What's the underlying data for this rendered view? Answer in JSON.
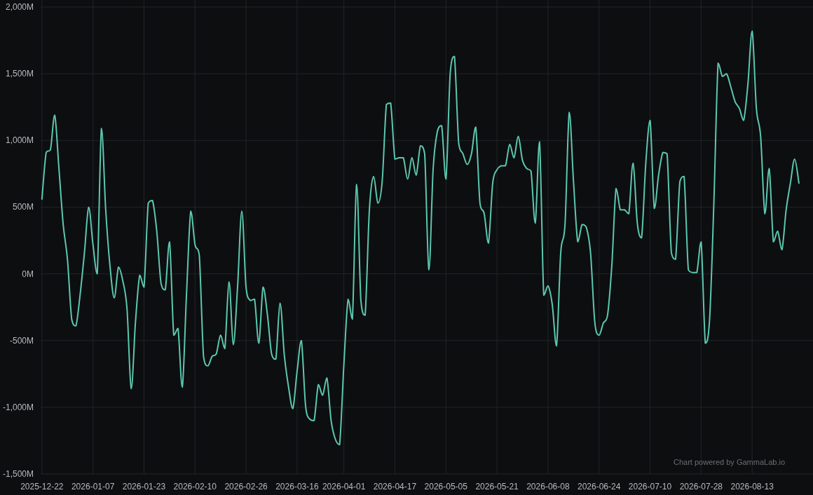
{
  "chart_data": {
    "type": "line",
    "grid": true,
    "ylim": [
      -1500,
      2000
    ],
    "categories": [
      "2025-12-22",
      null,
      null,
      null,
      null,
      null,
      null,
      null,
      null,
      null,
      null,
      null,
      "2026-01-07",
      null,
      null,
      null,
      null,
      null,
      null,
      null,
      null,
      null,
      null,
      null,
      "2026-01-23",
      null,
      null,
      null,
      null,
      null,
      null,
      null,
      null,
      null,
      null,
      null,
      "2026-02-10",
      null,
      null,
      null,
      null,
      null,
      null,
      null,
      null,
      null,
      null,
      null,
      "2026-02-26",
      null,
      null,
      null,
      null,
      null,
      null,
      null,
      null,
      null,
      null,
      null,
      "2026-03-16",
      null,
      null,
      null,
      null,
      null,
      null,
      null,
      null,
      null,
      null,
      "2026-04-01",
      null,
      null,
      null,
      null,
      null,
      null,
      null,
      null,
      null,
      null,
      null,
      "2026-04-17",
      null,
      null,
      null,
      null,
      null,
      null,
      null,
      null,
      null,
      null,
      null,
      "2026-05-05",
      null,
      null,
      null,
      null,
      null,
      null,
      null,
      null,
      null,
      null,
      null,
      "2026-05-21",
      null,
      null,
      null,
      null,
      null,
      null,
      null,
      null,
      null,
      null,
      null,
      "2026-06-08",
      null,
      null,
      null,
      null,
      null,
      null,
      null,
      null,
      null,
      null,
      null,
      "2026-06-24",
      null,
      null,
      null,
      null,
      null,
      null,
      null,
      null,
      null,
      null,
      null,
      "2026-07-10",
      null,
      null,
      null,
      null,
      null,
      null,
      null,
      null,
      null,
      null,
      null,
      "2026-07-28",
      null,
      null,
      null,
      null,
      null,
      null,
      null,
      null,
      null,
      null,
      null,
      "2026-08-13",
      null,
      null,
      null,
      null,
      null,
      null,
      null,
      null,
      null,
      null,
      null
    ],
    "yticks": [
      {
        "value": 2000,
        "label": "2,000M"
      },
      {
        "value": 1500,
        "label": "1,500M"
      },
      {
        "value": 1000,
        "label": "1,000M"
      },
      {
        "value": 500,
        "label": "500M"
      },
      {
        "value": 0,
        "label": "0M"
      },
      {
        "value": -500,
        "label": "-500M"
      },
      {
        "value": -1000,
        "label": "-1,000M"
      },
      {
        "value": -1500,
        "label": "-1,500M"
      }
    ],
    "series": [
      {
        "color": "#5cc8b0",
        "values": [
          560,
          910,
          930,
          1190,
          790,
          370,
          110,
          -340,
          -390,
          -150,
          160,
          500,
          220,
          0,
          1090,
          480,
          60,
          -180,
          50,
          -50,
          -260,
          -860,
          -360,
          -10,
          -100,
          530,
          550,
          320,
          -70,
          -120,
          240,
          -460,
          -410,
          -850,
          -150,
          470,
          220,
          140,
          -620,
          -690,
          -620,
          -600,
          -460,
          -560,
          -60,
          -530,
          -100,
          470,
          -100,
          -200,
          -190,
          -520,
          -100,
          -300,
          -600,
          -640,
          -220,
          -610,
          -850,
          -1010,
          -730,
          -500,
          -990,
          -1090,
          -1100,
          -830,
          -910,
          -780,
          -1100,
          -1240,
          -1280,
          -680,
          -190,
          -340,
          670,
          -200,
          -310,
          480,
          730,
          530,
          690,
          1270,
          1280,
          860,
          870,
          870,
          710,
          870,
          740,
          960,
          900,
          30,
          790,
          1070,
          1110,
          710,
          1500,
          1630,
          980,
          900,
          820,
          900,
          1100,
          530,
          450,
          230,
          680,
          780,
          810,
          810,
          970,
          870,
          1030,
          850,
          790,
          770,
          380,
          990,
          -160,
          -90,
          -230,
          -540,
          160,
          370,
          1210,
          690,
          240,
          370,
          350,
          160,
          -360,
          -460,
          -370,
          -310,
          60,
          640,
          480,
          480,
          450,
          830,
          380,
          270,
          830,
          1150,
          490,
          740,
          910,
          900,
          160,
          110,
          690,
          730,
          30,
          10,
          10,
          240,
          -520,
          -340,
          530,
          1580,
          1480,
          1500,
          1400,
          1290,
          1240,
          1150,
          1420,
          1820,
          1240,
          1030,
          450,
          790,
          240,
          320,
          180,
          480,
          680,
          860,
          680
        ]
      }
    ]
  },
  "attribution": "Chart powered by GammaLab.io"
}
